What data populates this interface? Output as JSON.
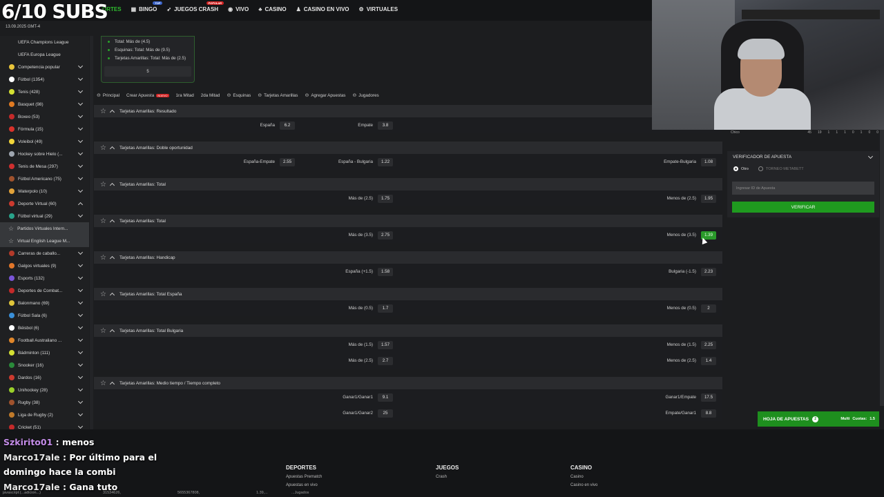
{
  "overlay": {
    "subs": "6/10 SUBS",
    "date": "13.09.2025  GMT-4"
  },
  "nav": {
    "items": [
      {
        "icon": "",
        "label": "ORTES",
        "badge": ""
      },
      {
        "icon": "bingo-icon",
        "label": "BINGO",
        "badge": "TOP"
      },
      {
        "icon": "rocket-icon",
        "label": "JUEGOS CRASH",
        "badge": "POPULAR"
      },
      {
        "icon": "live-icon",
        "label": "VIVO",
        "badge": ""
      },
      {
        "icon": "casino-icon",
        "label": "CASINO",
        "badge": ""
      },
      {
        "icon": "dealer-icon",
        "label": "CASINO EN VIVO",
        "badge": ""
      },
      {
        "icon": "virtual-icon",
        "label": "VIRTUALES",
        "badge": ""
      }
    ]
  },
  "sidebar": {
    "items": [
      {
        "label": "UEFA Champions League",
        "color": "",
        "chev": ""
      },
      {
        "label": "UEFA Europa League",
        "color": "",
        "chev": ""
      },
      {
        "label": "Competencia popular",
        "color": "#e8c43a",
        "chev": "down"
      },
      {
        "label": "Fútbol (1354)",
        "color": "#ffffff",
        "chev": "down"
      },
      {
        "label": "Tenis (428)",
        "color": "#d4e033",
        "chev": "down"
      },
      {
        "label": "Basquet (98)",
        "color": "#e07a22",
        "chev": "down"
      },
      {
        "label": "Boxeo (53)",
        "color": "#c42a2a",
        "chev": "down"
      },
      {
        "label": "Fórmula (15)",
        "color": "#d9322b",
        "chev": "down"
      },
      {
        "label": "Voleibol (49)",
        "color": "#f1d53a",
        "chev": "down"
      },
      {
        "label": "Hockey sobre Hielo (...",
        "color": "#9fa6b0",
        "chev": "down"
      },
      {
        "label": "Tenis de Mesa (297)",
        "color": "#cf2f2f",
        "chev": "down"
      },
      {
        "label": "Fútbol Americano (75)",
        "color": "#a0522d",
        "chev": "down"
      },
      {
        "label": "Waterpolo (10)",
        "color": "#e2a23a",
        "chev": "down"
      },
      {
        "label": "Deporte Virtual (60)",
        "color": "#cc3a2f",
        "chev": "up"
      },
      {
        "label": "Fútbol virtual (29)",
        "color": "#29a38a",
        "chev": "down"
      },
      {
        "label": "Partidos Virtuales Intern...",
        "color": "",
        "chev": "",
        "hl": true
      },
      {
        "label": "Virtual English League M...",
        "color": "",
        "chev": "",
        "hl": true
      },
      {
        "label": "Carreras de caballo...",
        "color": "#b33a2a",
        "chev": "down"
      },
      {
        "label": "Galgos virtuales (9)",
        "color": "#e2762a",
        "chev": "down"
      },
      {
        "label": "Esports (132)",
        "color": "#7a55d8",
        "chev": "down"
      },
      {
        "label": "Deportes de Combat...",
        "color": "#c42a2a",
        "chev": "down"
      },
      {
        "label": "Balonmano (69)",
        "color": "#e0c53a",
        "chev": "down"
      },
      {
        "label": "Fútbol Sala (6)",
        "color": "#3a8fd8",
        "chev": "down"
      },
      {
        "label": "Béisbol (6)",
        "color": "#ffffff",
        "chev": "down"
      },
      {
        "label": "Football Australiano ...",
        "color": "#e0862a",
        "chev": "down"
      },
      {
        "label": "Bádminton (111)",
        "color": "#d4e033",
        "chev": "down"
      },
      {
        "label": "Snooker (16)",
        "color": "#2a8a3a",
        "chev": "down"
      },
      {
        "label": "Dardos (16)",
        "color": "#cc3a2f",
        "chev": "down"
      },
      {
        "label": "Unihockey (28)",
        "color": "#9ad02a",
        "chev": "down"
      },
      {
        "label": "Rugby (38)",
        "color": "#a0522d",
        "chev": "down"
      },
      {
        "label": "Liga de Rugby (2)",
        "color": "#c07a2a",
        "chev": "down"
      },
      {
        "label": "Cricket (51)",
        "color": "#c42a2a",
        "chev": "down"
      }
    ]
  },
  "summary": {
    "lines": [
      "Total: Más de (4.5)",
      "Esquinas: Total: Más de (9.5)",
      "Tarjetas Amarillas: Total: Más de (2.5)"
    ],
    "footer": "5"
  },
  "tabs": [
    {
      "label": "Principal",
      "link": true,
      "badge": ""
    },
    {
      "label": "Crear Apuesta",
      "link": false,
      "badge": "NUEVO"
    },
    {
      "label": "1ra Mitad",
      "link": false,
      "badge": ""
    },
    {
      "label": "2da Mitad",
      "link": false,
      "badge": ""
    },
    {
      "label": "Esquinas",
      "link": true,
      "badge": ""
    },
    {
      "label": "Tarjetas Amarillas",
      "link": true,
      "badge": ""
    },
    {
      "label": "Agregar Apuestas",
      "link": true,
      "badge": ""
    },
    {
      "label": "Jugadores",
      "link": true,
      "badge": ""
    }
  ],
  "markets": [
    {
      "title": "Tarjetas Amarillas: Resultado",
      "rows": [
        [
          {
            "l": "España",
            "o": "6.2"
          },
          {
            "l": "Empate",
            "o": "3.8"
          },
          null
        ]
      ]
    },
    {
      "title": "Tarjetas Amarillas: Doble oportunidad",
      "rows": [
        [
          {
            "l": "España-Empate",
            "o": "2.55"
          },
          {
            "l": "España - Bulgaria",
            "o": "1.22"
          },
          {
            "l": "Empate-Bulgaria",
            "o": "1.08"
          }
        ]
      ]
    },
    {
      "title": "Tarjetas Amarillas: Total",
      "rows": [
        [
          null,
          {
            "l": "Más de (2.5)",
            "o": "1.75"
          },
          {
            "l": "Menos de (2.5)",
            "o": "1.95"
          }
        ]
      ]
    },
    {
      "title": "Tarjetas Amarillas: Total",
      "rows": [
        [
          null,
          {
            "l": "Más de (3.5)",
            "o": "2.75"
          },
          {
            "l": "Menos de (3.5)",
            "o": "1.39",
            "active": true
          }
        ]
      ]
    },
    {
      "title": "Tarjetas Amarillas: Handicap",
      "rows": [
        [
          null,
          {
            "l": "España (+1.5)",
            "o": "1.58"
          },
          {
            "l": "Bulgaria (-1.5)",
            "o": "2.23"
          }
        ]
      ]
    },
    {
      "title": "Tarjetas Amarillas: Total España",
      "rows": [
        [
          null,
          {
            "l": "Más de (0.5)",
            "o": "1.7"
          },
          {
            "l": "Menos de (0.5)",
            "o": "2"
          }
        ]
      ]
    },
    {
      "title": "Tarjetas Amarillas: Total Bulgaria",
      "rows": [
        [
          null,
          {
            "l": "Más de (1.5)",
            "o": "1.57"
          },
          {
            "l": "Menos de (1.5)",
            "o": "2.25"
          }
        ],
        [
          null,
          {
            "l": "Más de (2.5)",
            "o": "2.7"
          },
          {
            "l": "Menos de (2.5)",
            "o": "1.4"
          }
        ]
      ]
    },
    {
      "title": "Tarjetas Amarillas: Medio tiempo / Tiempo completo",
      "rows": [
        [
          null,
          {
            "l": "Ganar1/Ganar1",
            "o": "9.1"
          },
          {
            "l": "Ganar1/Empate",
            "o": "17.5"
          }
        ],
        [
          null,
          {
            "l": "Ganar1/Ganar2",
            "o": "25"
          },
          {
            "l": "Empate/Ganar1",
            "o": "8.8"
          }
        ]
      ]
    }
  ],
  "scorebar": {
    "label": "Chico",
    "values": [
      "45",
      "19",
      "1",
      "1",
      "1",
      "0",
      "1",
      "0",
      "0"
    ]
  },
  "verificador": {
    "title": "VERIFICADOR DE APUESTA",
    "radio1": "Otro",
    "radio2": "TORNEO METABETT",
    "placeholder": "Ingresar ID de Apuesta",
    "button": "VERIFICAR"
  },
  "hoja": {
    "label": "HOJA DE APUESTAS",
    "count": "2",
    "mode": "Multi",
    "cuotas_label": "Cuotas:",
    "cuotas": "1.5"
  },
  "footer": {
    "cols": [
      {
        "title": "DEPORTES",
        "links": [
          "Apuestas Prematch",
          "Apuestas en vivo"
        ]
      },
      {
        "title": "JUEGOS",
        "links": [
          "Crash"
        ]
      },
      {
        "title": "CASINO",
        "links": [
          "Casino",
          "Casino en vivo"
        ]
      }
    ]
  },
  "chat": [
    {
      "user": "Szkirito01",
      "msg": " : menos",
      "color": "#c48ce8"
    },
    {
      "user": "Marco17ale",
      "msg": " : Por último para el domingo hace la combi",
      "color": "#e6e6e6"
    },
    {
      "user": "Marco17ale",
      "msg": " : Gana tuto",
      "color": "#e6e6e6"
    }
  ],
  "statusbar": [
    "javascript:(...adicion...)",
    "31534626,",
    "5655367808,",
    "1.39,...",
    "...Jugados"
  ]
}
